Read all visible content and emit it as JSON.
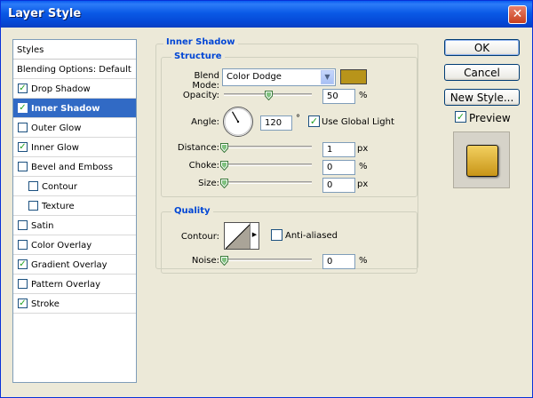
{
  "window": {
    "title": "Layer Style",
    "close_glyph": "✕"
  },
  "styles_panel": {
    "header": "Styles",
    "blending_options": "Blending Options: Default",
    "items": [
      {
        "label": "Drop Shadow",
        "checked": true,
        "selected": false,
        "indent": false
      },
      {
        "label": "Inner Shadow",
        "checked": true,
        "selected": true,
        "indent": false
      },
      {
        "label": "Outer Glow",
        "checked": false,
        "selected": false,
        "indent": false
      },
      {
        "label": "Inner Glow",
        "checked": true,
        "selected": false,
        "indent": false
      },
      {
        "label": "Bevel and Emboss",
        "checked": false,
        "selected": false,
        "indent": false
      },
      {
        "label": "Contour",
        "checked": false,
        "selected": false,
        "indent": true
      },
      {
        "label": "Texture",
        "checked": false,
        "selected": false,
        "indent": true
      },
      {
        "label": "Satin",
        "checked": false,
        "selected": false,
        "indent": false
      },
      {
        "label": "Color Overlay",
        "checked": false,
        "selected": false,
        "indent": false
      },
      {
        "label": "Gradient Overlay",
        "checked": true,
        "selected": false,
        "indent": false
      },
      {
        "label": "Pattern Overlay",
        "checked": false,
        "selected": false,
        "indent": false
      },
      {
        "label": "Stroke",
        "checked": true,
        "selected": false,
        "indent": false
      }
    ]
  },
  "inner_shadow": {
    "section_title": "Inner Shadow",
    "structure_title": "Structure",
    "blend_mode": {
      "label": "Blend Mode:",
      "value": "Color Dodge",
      "swatch_color": "#b8941a"
    },
    "opacity": {
      "label": "Opacity:",
      "value": "50",
      "unit": "%",
      "slider_fraction": 0.5
    },
    "angle": {
      "label": "Angle:",
      "value": "120",
      "unit": "°",
      "degrees": 120
    },
    "use_global_light": {
      "label": "Use Global Light",
      "checked": true
    },
    "distance": {
      "label": "Distance:",
      "value": "1",
      "unit": "px",
      "slider_fraction": 0.0
    },
    "choke": {
      "label": "Choke:",
      "value": "0",
      "unit": "%",
      "slider_fraction": 0.0
    },
    "size": {
      "label": "Size:",
      "value": "0",
      "unit": "px",
      "slider_fraction": 0.0
    }
  },
  "quality": {
    "title": "Quality",
    "contour_label": "Contour:",
    "anti_aliased": {
      "label": "Anti-aliased",
      "checked": false
    },
    "noise": {
      "label": "Noise:",
      "value": "0",
      "unit": "%",
      "slider_fraction": 0.0
    }
  },
  "buttons": {
    "ok": "OK",
    "cancel": "Cancel",
    "new_style": "New Style...",
    "preview": {
      "label": "Preview",
      "checked": true
    }
  },
  "glyphs": {
    "check": "✓",
    "dropdown_arrow": "▼",
    "small_arrow": "▶"
  }
}
